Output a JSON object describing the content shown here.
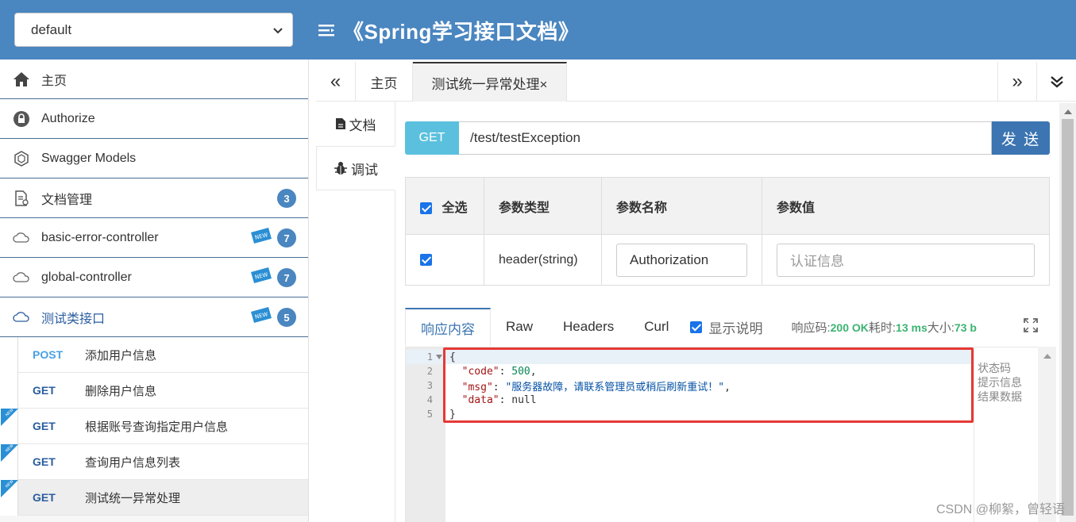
{
  "header": {
    "group_select": "default",
    "title": "《Spring学习接口文档》"
  },
  "sidebar": {
    "items": [
      {
        "label": "主页",
        "icon": "home-icon"
      },
      {
        "label": "Authorize",
        "icon": "lock-icon"
      },
      {
        "label": "Swagger Models",
        "icon": "models-icon"
      },
      {
        "label": "文档管理",
        "icon": "document-icon",
        "badge": "3"
      },
      {
        "label": "basic-error-controller",
        "icon": "api-cloud-icon",
        "badge": "7",
        "new": true
      },
      {
        "label": "global-controller",
        "icon": "api-cloud-icon",
        "badge": "7",
        "new": true
      },
      {
        "label": "测试类接口",
        "icon": "api-cloud-icon",
        "badge": "5",
        "new": true
      }
    ],
    "sub_items": [
      {
        "method": "POST",
        "label": "添加用户信息"
      },
      {
        "method": "GET",
        "label": "删除用户信息"
      },
      {
        "method": "GET",
        "label": "根据账号查询指定用户信息"
      },
      {
        "method": "GET",
        "label": "查询用户信息列表"
      },
      {
        "method": "GET",
        "label": "测试统一异常处理"
      }
    ]
  },
  "tabs": {
    "home": "主页",
    "active": "测试统一异常处理×",
    "prev": "«",
    "next": "»"
  },
  "vtabs": {
    "doc": "文档",
    "debug": "调试"
  },
  "request": {
    "method": "GET",
    "url": "/test/testException",
    "send": "发 送"
  },
  "params": {
    "headers": [
      "全选",
      "参数类型",
      "参数名称",
      "参数值"
    ],
    "row": {
      "type": "header(string)",
      "name": "Authorization",
      "value_placeholder": "认证信息"
    }
  },
  "response": {
    "tabs": [
      "响应内容",
      "Raw",
      "Headers",
      "Curl"
    ],
    "show_desc": "显示说明",
    "status_label": "响应码:",
    "status_value": "200 OK",
    "time_label": "耗时:",
    "time_value": "13 ms",
    "size_label": "大小:",
    "size_value": "73 b",
    "lines": [
      "1",
      "2",
      "3",
      "4",
      "5"
    ],
    "code": {
      "open": "{",
      "code_key": "\"code\"",
      "code_val": "500",
      "msg_key": "\"msg\"",
      "msg_val": "\"服务器故障，请联系管理员或稍后刷新重试！\"",
      "data_key": "\"data\"",
      "data_val": "null",
      "close": "}"
    },
    "notes": [
      "状态码",
      "提示信息",
      "结果数据"
    ]
  },
  "watermark": "CSDN @柳絮，曾轻语"
}
